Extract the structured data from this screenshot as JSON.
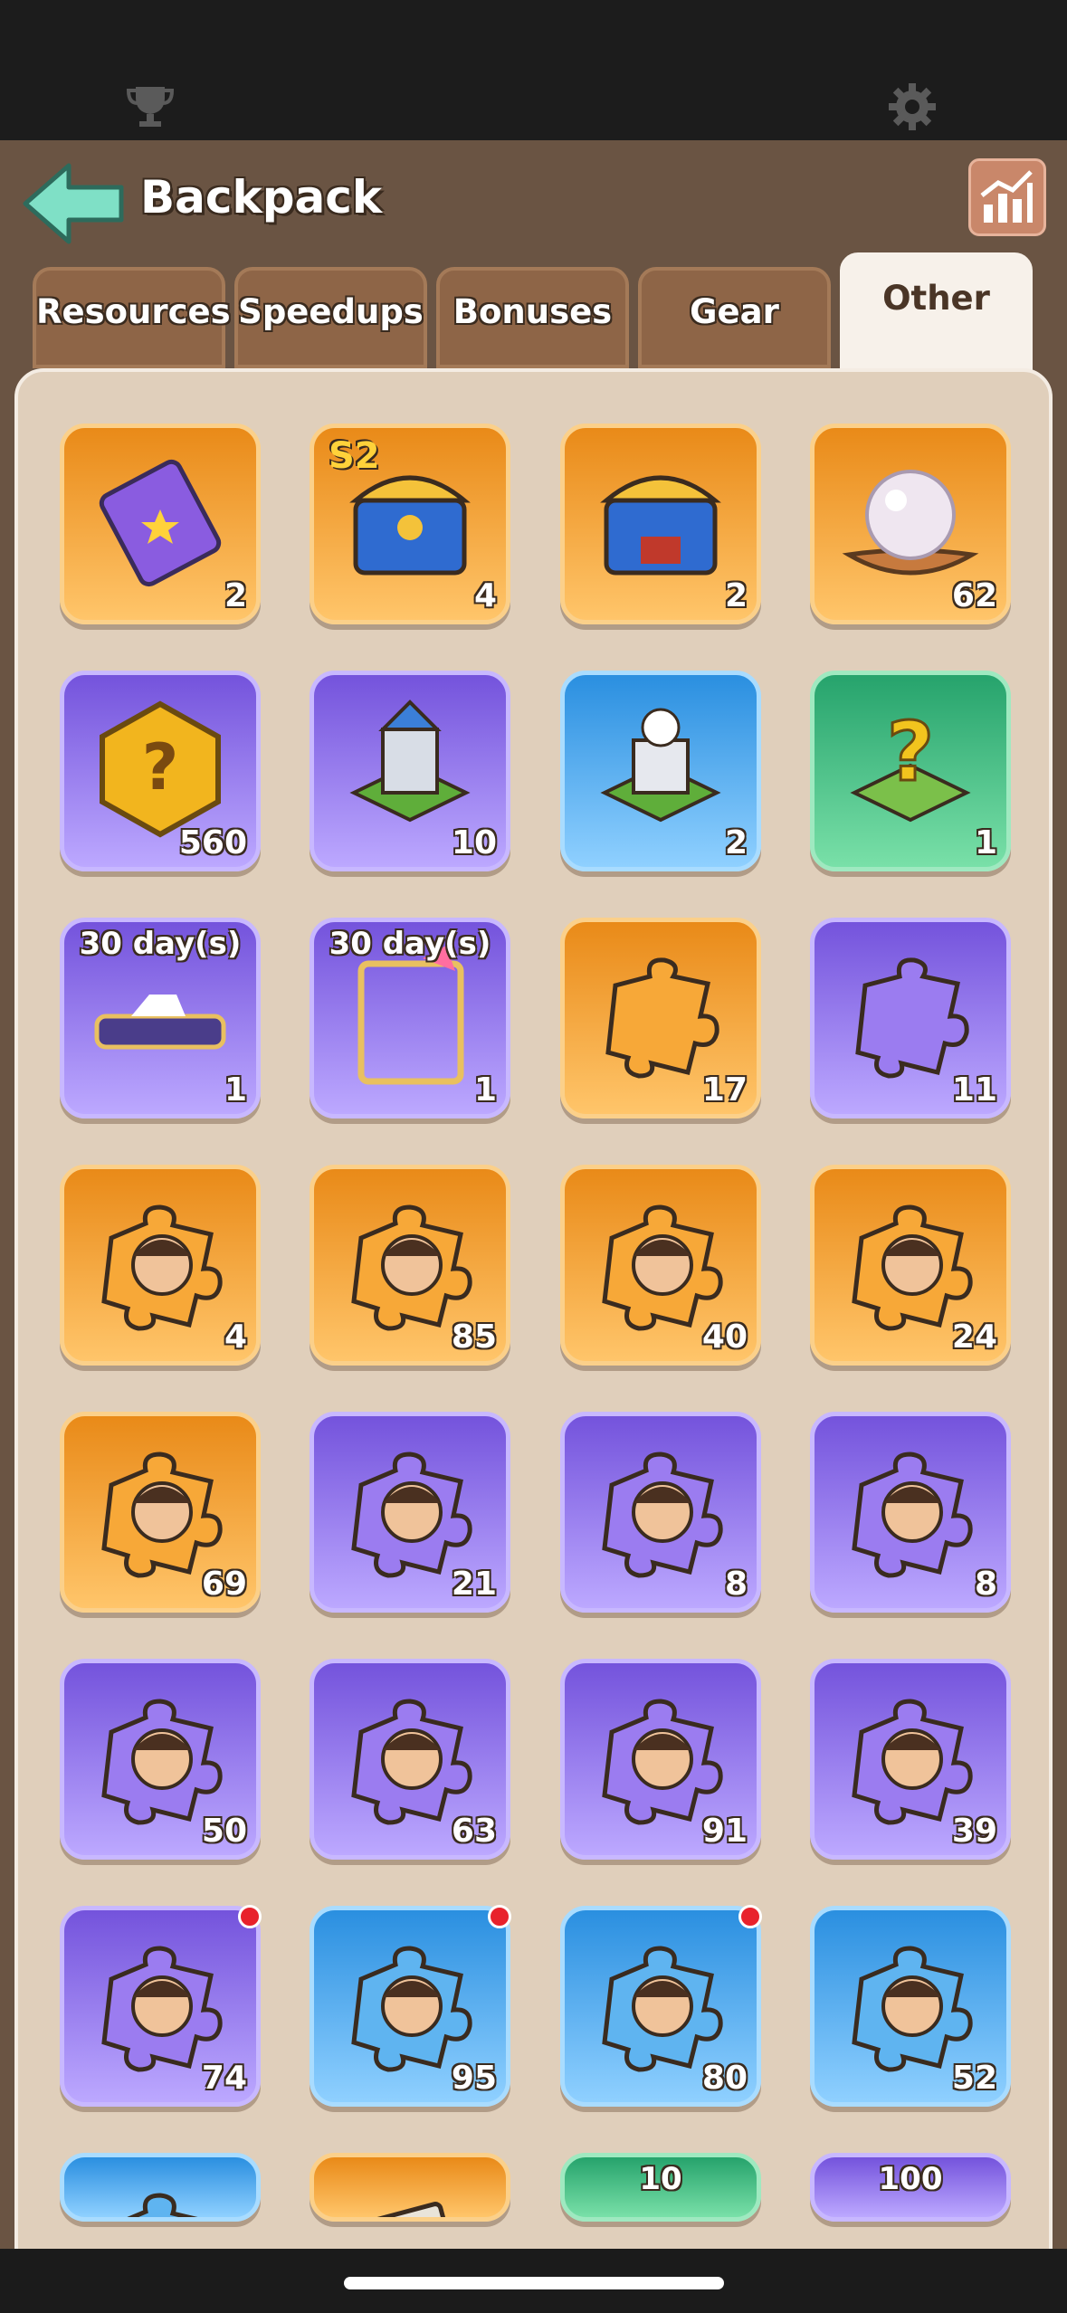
{
  "header": {
    "title": "Backpack",
    "back_icon": "back-arrow-icon",
    "stats_icon": "bar-chart-icon"
  },
  "topbar": {
    "left_icon": "trophy-icon",
    "right_icon": "gear-icon"
  },
  "tabs": [
    {
      "label": "Resources",
      "active": false
    },
    {
      "label": "Speedups",
      "active": false
    },
    {
      "label": "Bonuses",
      "active": false
    },
    {
      "label": "Gear",
      "active": false
    },
    {
      "label": "Other",
      "active": true
    }
  ],
  "items": [
    {
      "icon": "ticket-icon",
      "tier": "orange",
      "qty": "2"
    },
    {
      "icon": "season-chest-icon",
      "tier": "orange",
      "qty": "4",
      "tag": "S2"
    },
    {
      "icon": "chest-icon",
      "tier": "orange",
      "qty": "2"
    },
    {
      "icon": "pearl-icon",
      "tier": "orange",
      "qty": "62"
    },
    {
      "icon": "mystery-hexagon-icon",
      "tier": "purple",
      "qty": "560"
    },
    {
      "icon": "castle-relocate-icon",
      "tier": "purple",
      "qty": "10"
    },
    {
      "icon": "castle-teleport-icon",
      "tier": "blue",
      "qty": "2"
    },
    {
      "icon": "random-teleport-icon",
      "tier": "green",
      "qty": "1"
    },
    {
      "icon": "nameplate-icon",
      "tier": "purple",
      "qty": "1",
      "days": "30 day(s)"
    },
    {
      "icon": "avatar-frame-icon",
      "tier": "purple",
      "qty": "1",
      "days": "30 day(s)"
    },
    {
      "icon": "puzzle-piece-icon",
      "tier": "orange",
      "qty": "17"
    },
    {
      "icon": "puzzle-piece-icon",
      "tier": "purple",
      "qty": "11"
    },
    {
      "icon": "hero-shard-icon",
      "tier": "orange",
      "qty": "4"
    },
    {
      "icon": "hero-shard-icon",
      "tier": "orange",
      "qty": "85"
    },
    {
      "icon": "hero-shard-icon",
      "tier": "orange",
      "qty": "40"
    },
    {
      "icon": "hero-shard-icon",
      "tier": "orange",
      "qty": "24"
    },
    {
      "icon": "hero-shard-icon",
      "tier": "orange",
      "qty": "69"
    },
    {
      "icon": "hero-shard-icon",
      "tier": "purple",
      "qty": "21"
    },
    {
      "icon": "hero-shard-icon",
      "tier": "purple",
      "qty": "8"
    },
    {
      "icon": "hero-shard-icon",
      "tier": "purple",
      "qty": "8"
    },
    {
      "icon": "hero-shard-icon",
      "tier": "purple",
      "qty": "50"
    },
    {
      "icon": "hero-shard-icon",
      "tier": "purple",
      "qty": "63"
    },
    {
      "icon": "hero-shard-icon",
      "tier": "purple",
      "qty": "91"
    },
    {
      "icon": "hero-shard-icon",
      "tier": "purple",
      "qty": "39"
    },
    {
      "icon": "hero-shard-icon",
      "tier": "purple",
      "qty": "74",
      "alert": true
    },
    {
      "icon": "hero-shard-icon",
      "tier": "blue",
      "qty": "95",
      "alert": true
    },
    {
      "icon": "hero-shard-icon",
      "tier": "blue",
      "qty": "80",
      "alert": true
    },
    {
      "icon": "hero-shard-icon",
      "tier": "blue",
      "qty": "52"
    },
    {
      "icon": "hero-shard-icon",
      "tier": "blue",
      "qty": ""
    },
    {
      "icon": "scroll-icon",
      "tier": "orange",
      "qty": ""
    },
    {
      "icon": "resource-pack-icon",
      "tier": "green",
      "qty": "",
      "days": "10"
    },
    {
      "icon": "resource-pack-icon",
      "tier": "purple",
      "qty": "",
      "days": "100"
    }
  ],
  "colors": {
    "orange": "#e98a18",
    "purple": "#7453dc",
    "blue": "#2a8fe0",
    "green": "#26a36c",
    "alert": "#e8222c"
  }
}
